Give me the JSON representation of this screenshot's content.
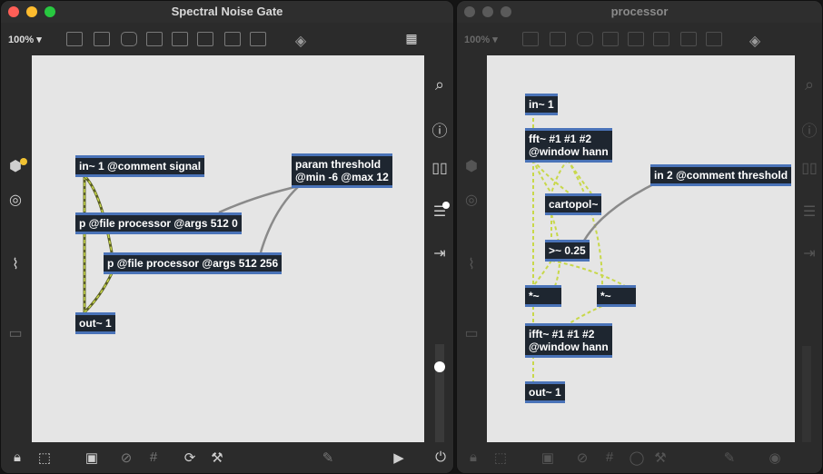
{
  "left_window": {
    "title": "Spectral Noise Gate",
    "zoom": "100%",
    "objects": {
      "in1": "in~ 1 @comment signal",
      "param": [
        "param threshold",
        "@min -6 @max 12"
      ],
      "p1": "p @file processor @args 512 0",
      "p2": "p @file processor @args 512 256",
      "out1": "out~ 1"
    }
  },
  "right_window": {
    "title": "processor",
    "zoom": "100%",
    "objects": {
      "in1": "in~ 1",
      "fft": [
        "fft~ #1 #1 #2",
        "@window hann"
      ],
      "in2": "in 2 @comment threshold",
      "cartopol": "cartopol~",
      "gte": ">~ 0.25",
      "mul1": "*~",
      "mul2": "*~",
      "ifft": [
        "ifft~ #1 #1 #2",
        "@window hann"
      ],
      "out1": "out~ 1"
    }
  },
  "colors": {
    "accent": "#4a73b8",
    "object_bg": "#1e2630",
    "canvas": "#e5e5e5",
    "signal_cord": "#b9c93c"
  },
  "icons": [
    "lock-icon",
    "presentation-icon",
    "new-object-icon",
    "grid-icon",
    "refresh-icon",
    "hammer-icon",
    "play-icon",
    "power-icon",
    "search-icon",
    "info-icon",
    "book-icon",
    "list-icon",
    "export-icon",
    "cube-icon",
    "target-icon",
    "paperclip-icon"
  ]
}
